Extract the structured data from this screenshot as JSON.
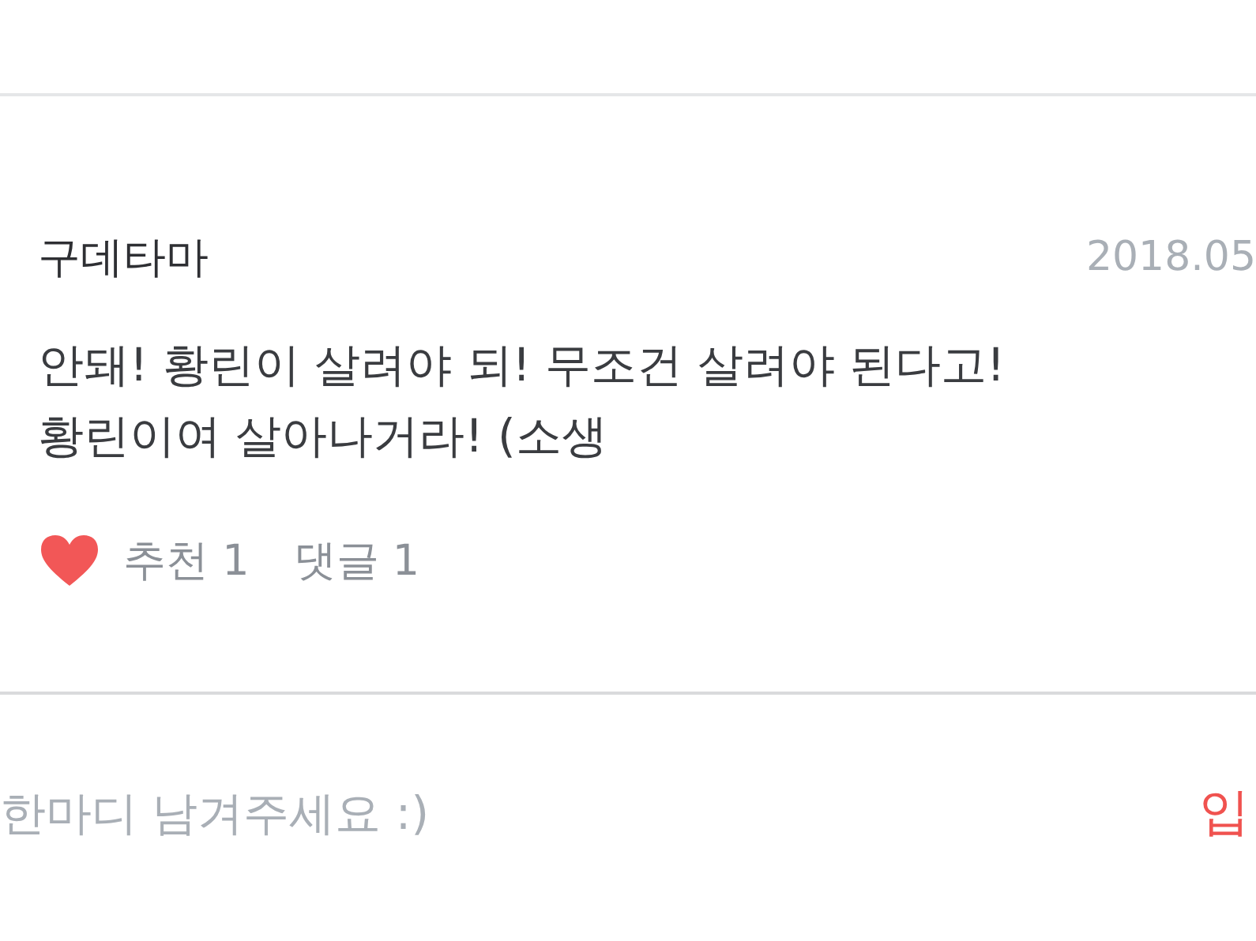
{
  "comment": {
    "author": "구데타마",
    "date": "2018.05",
    "lines": [
      "안돼! 황린이 살려야 되! 무조건 살려야 된다고!",
      "황린이여 살아나거라! (소생"
    ],
    "liked": true,
    "likes": "추천 1",
    "replies": "댓글 1"
  },
  "reply_box": {
    "placeholder": "한마디 남겨주세요 :)",
    "submit": "입"
  }
}
